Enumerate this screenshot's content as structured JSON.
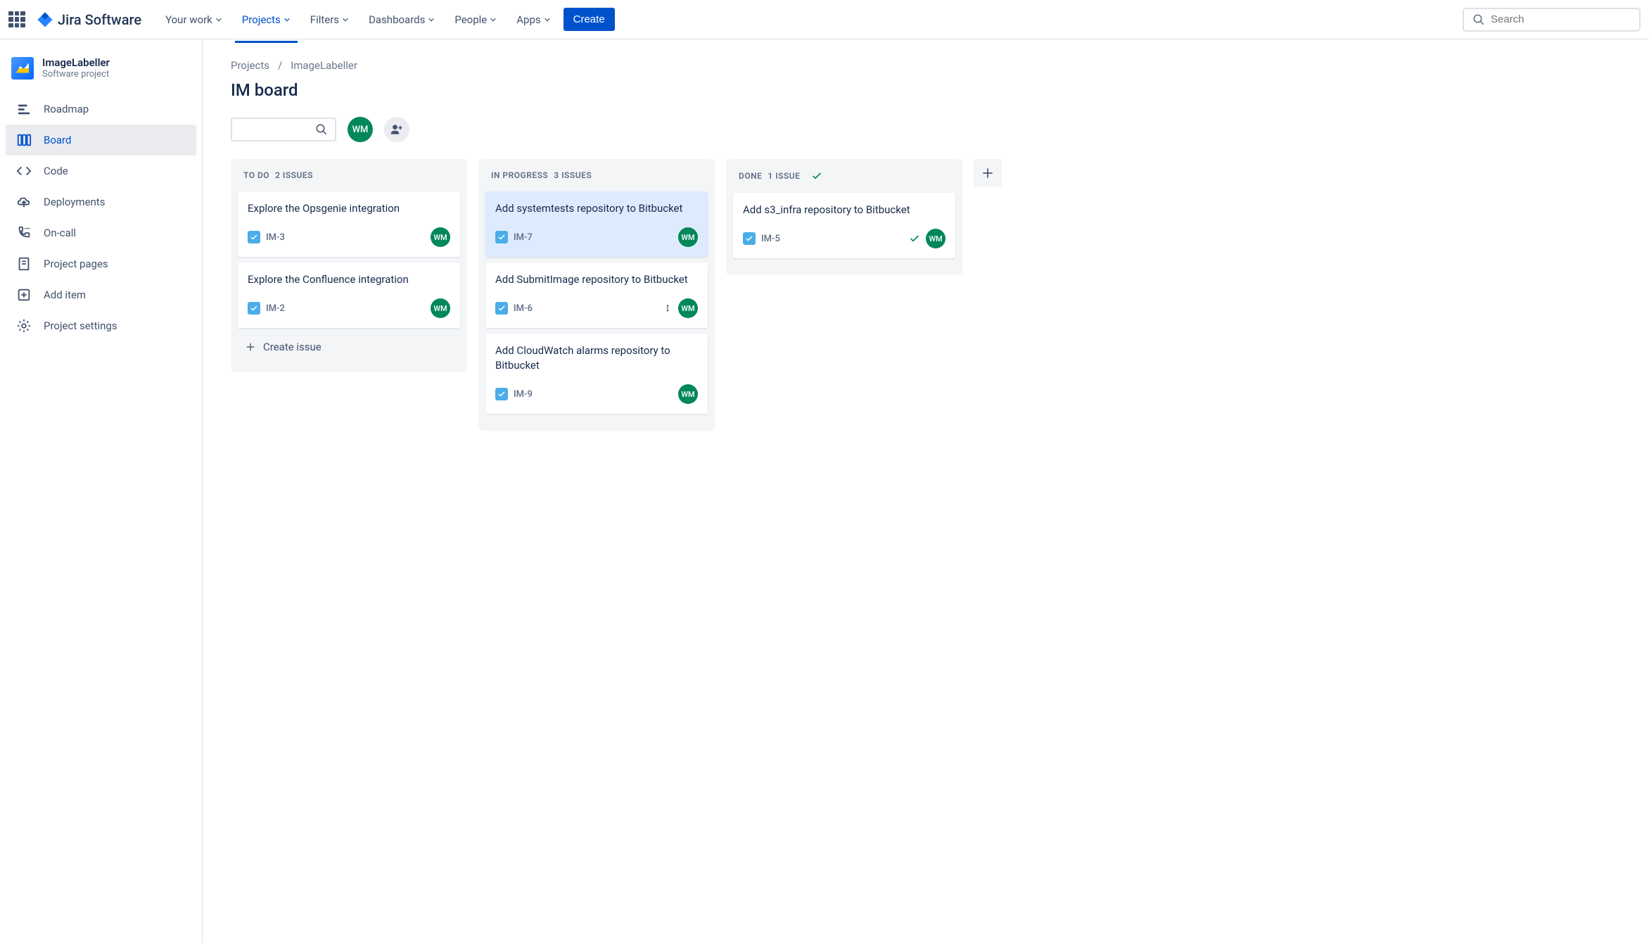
{
  "topnav": {
    "product": "Jira Software",
    "items": [
      "Your work",
      "Projects",
      "Filters",
      "Dashboards",
      "People",
      "Apps"
    ],
    "active_index": 1,
    "create_label": "Create",
    "search_placeholder": "Search"
  },
  "sidebar": {
    "project_name": "ImageLabeller",
    "project_type": "Software project",
    "items": [
      {
        "label": "Roadmap",
        "icon": "roadmap"
      },
      {
        "label": "Board",
        "icon": "board"
      },
      {
        "label": "Code",
        "icon": "code"
      },
      {
        "label": "Deployments",
        "icon": "deployments"
      },
      {
        "label": "On-call",
        "icon": "on-call"
      },
      {
        "label": "Project pages",
        "icon": "pages"
      },
      {
        "label": "Add item",
        "icon": "add"
      },
      {
        "label": "Project settings",
        "icon": "settings"
      }
    ],
    "active_index": 1
  },
  "breadcrumb": {
    "root": "Projects",
    "current": "ImageLabeller"
  },
  "page_title": "IM board",
  "avatar_initials": "WM",
  "columns": [
    {
      "name": "TO DO",
      "count_label": "2 ISSUES",
      "cards": [
        {
          "title": "Explore the Opsgenie integration",
          "key": "IM-3",
          "assignee": "WM"
        },
        {
          "title": "Explore the Confluence integration",
          "key": "IM-2",
          "assignee": "WM"
        }
      ],
      "create_label": "Create issue"
    },
    {
      "name": "IN PROGRESS",
      "count_label": "3 ISSUES",
      "cards": [
        {
          "title": "Add systemtests repository to Bitbucket",
          "key": "IM-7",
          "assignee": "WM",
          "selected": true
        },
        {
          "title": "Add SubmitImage repository to Bitbucket",
          "key": "IM-6",
          "assignee": "WM",
          "priority": true
        },
        {
          "title": "Add CloudWatch alarms repository to Bitbucket",
          "key": "IM-9",
          "assignee": "WM"
        }
      ]
    },
    {
      "name": "DONE",
      "count_label": "1 ISSUE",
      "done": true,
      "cards": [
        {
          "title": "Add s3_infra repository to Bitbucket",
          "key": "IM-5",
          "assignee": "WM",
          "done": true
        }
      ]
    }
  ]
}
